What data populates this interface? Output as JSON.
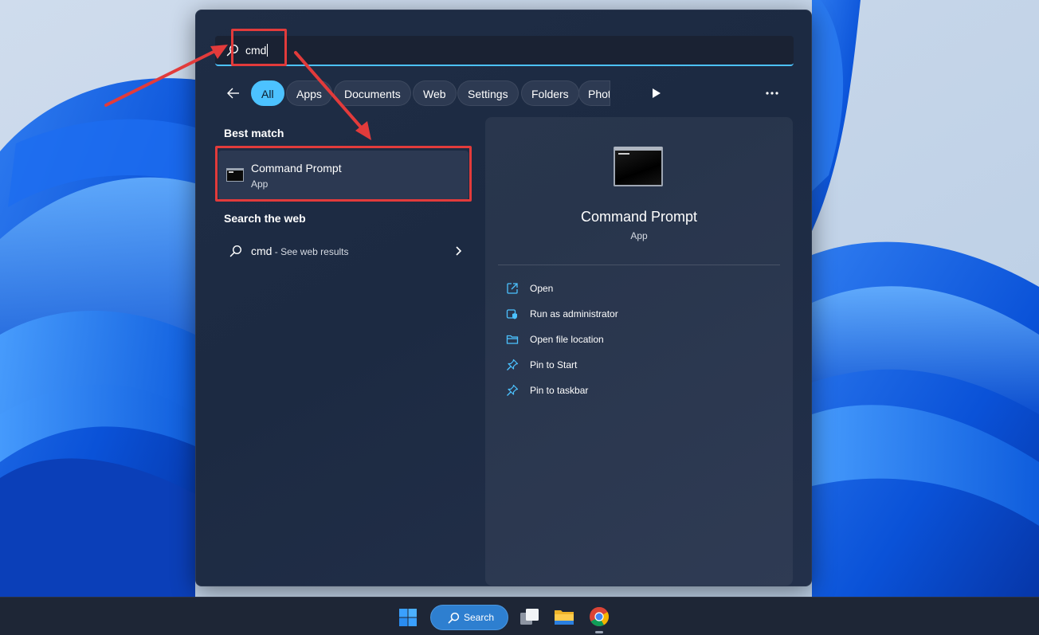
{
  "search": {
    "query": "cmd"
  },
  "filters": {
    "chips": [
      "All",
      "Apps",
      "Documents",
      "Web",
      "Settings",
      "Folders",
      "Phot"
    ],
    "active": "All"
  },
  "best_match": {
    "section_label": "Best match",
    "title": "Command Prompt",
    "subtitle": "App"
  },
  "web": {
    "section_label": "Search the web",
    "term": "cmd",
    "hint": " - See web results"
  },
  "details": {
    "app_name": "Command Prompt",
    "app_kind": "App",
    "actions": [
      {
        "label": "Open",
        "icon": "open-external-icon"
      },
      {
        "label": "Run as administrator",
        "icon": "shield-admin-icon"
      },
      {
        "label": "Open file location",
        "icon": "folder-icon"
      },
      {
        "label": "Pin to Start",
        "icon": "pin-icon"
      },
      {
        "label": "Pin to taskbar",
        "icon": "pin-icon"
      }
    ]
  },
  "taskbar": {
    "search_label": "Search",
    "apps": [
      "start-icon",
      "task-view-icon",
      "file-explorer-icon",
      "chrome-icon"
    ]
  },
  "colors": {
    "accent": "#4cc2ff",
    "annotation": "#e23b3b",
    "flyout_bg": "#1f2d45",
    "taskbar_bg": "#1e2636"
  }
}
